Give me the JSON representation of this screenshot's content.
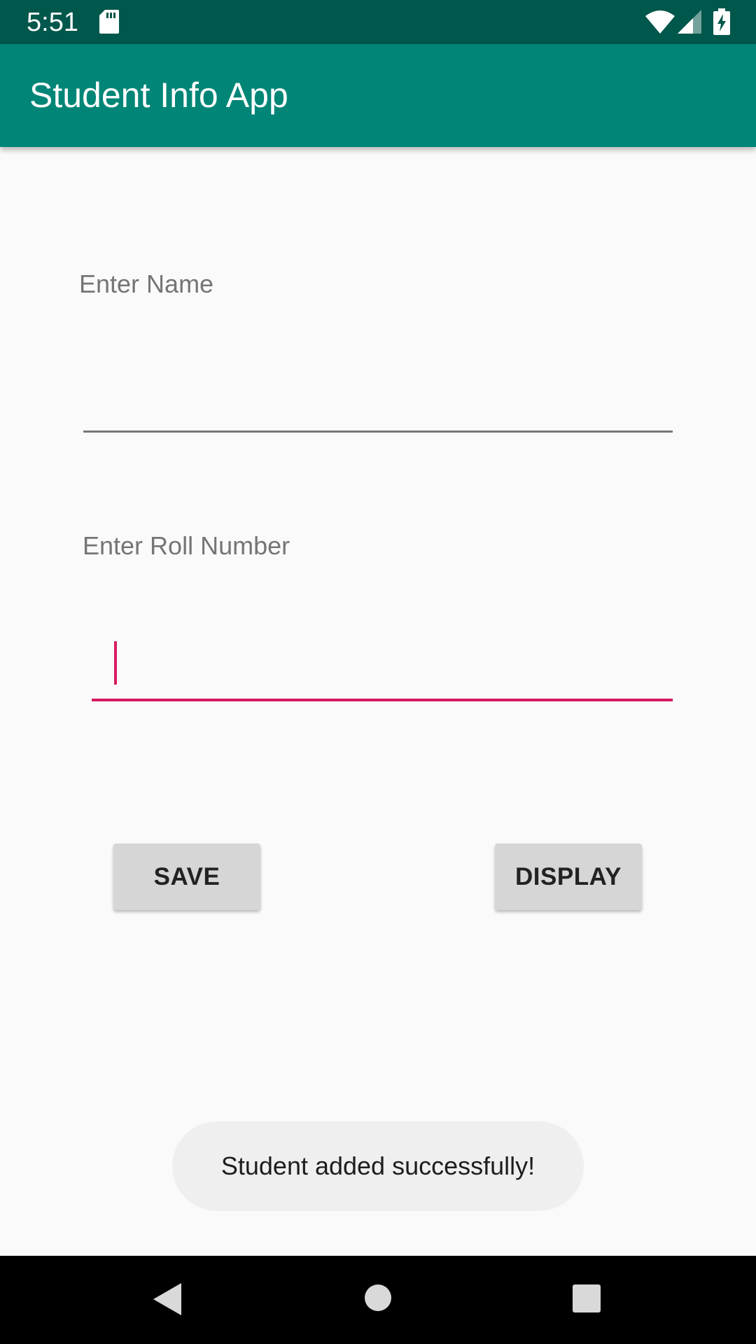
{
  "status_bar": {
    "time": "5:51",
    "icons": [
      "sd-card-icon",
      "wifi-icon",
      "signal-icon",
      "battery-charging-icon"
    ]
  },
  "app_bar": {
    "title": "Student Info App",
    "color": "#008577"
  },
  "form": {
    "name_label": "Enter Name",
    "name_value": "",
    "roll_label": "Enter Roll Number",
    "roll_value": ""
  },
  "buttons": {
    "save_label": "SAVE",
    "display_label": "DISPLAY"
  },
  "toast": {
    "message": "Student added successfully!"
  },
  "nav_bar": {
    "icons": [
      "back-icon",
      "home-icon",
      "recents-icon"
    ]
  },
  "colors": {
    "status_bar": "#00574b",
    "primary": "#008577",
    "accent": "#d81b60",
    "background": "#fafafa"
  }
}
